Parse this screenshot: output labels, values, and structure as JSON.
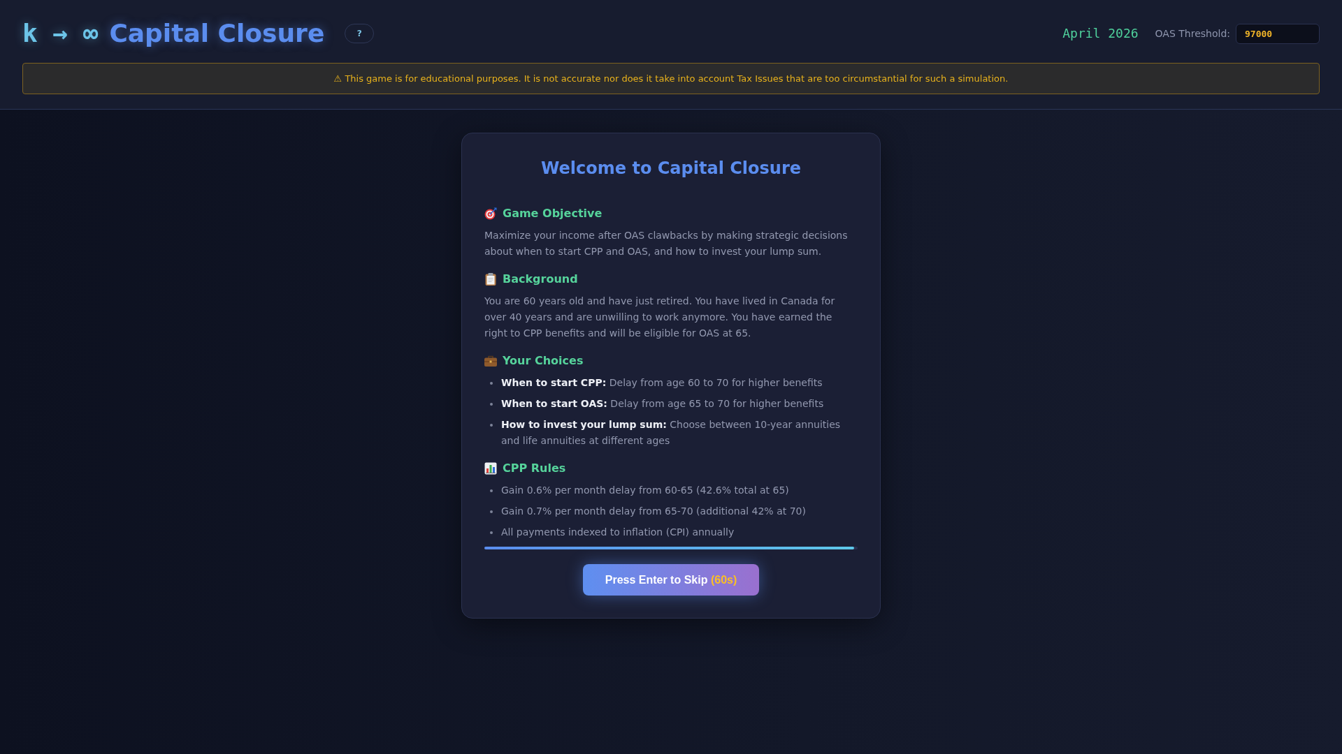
{
  "header": {
    "logo_prefix": "k → ∞",
    "title": "Capital Closure",
    "help_button": "?",
    "date": "April 2026",
    "threshold": {
      "label": "OAS Threshold:",
      "value": "97000"
    }
  },
  "disclaimer": "⚠ This game is for educational purposes. It is not accurate nor does it take into account Tax Issues that are too circumstantial for such a simulation.",
  "welcome_dialog": {
    "title": "Welcome to Capital Closure",
    "sections": [
      {
        "kind": "paragraph",
        "heading": "Game Objective",
        "text": "Maximize your income after OAS clawbacks by making strategic decisions about when to start CPP and OAS, and how to invest your lump sum."
      },
      {
        "kind": "paragraph",
        "heading": "Background",
        "text": "You are 60 years old and have just retired. You have lived in Canada for over 40 years and are unwilling to work anymore. You have earned the right to CPP benefits and will be eligible for OAS at 65."
      },
      {
        "kind": "list",
        "heading": "Your Choices",
        "items": [
          "**When to start CPP:** Delay from age 60 to 70 for higher benefits",
          "**When to start OAS:** Delay from age 65 to 70 for higher benefits",
          "**How to invest your lump sum:** Choose between 10-year annuities and life annuities at different ages"
        ]
      },
      {
        "kind": "list",
        "heading": "CPP Rules",
        "items": [
          "Gain 0.6% per month delay from 60-65 (42.6% total at 65)",
          "Gain 0.7% per month delay from 65-70 (additional 42% at 70)",
          "All payments indexed to inflation (CPI) annually"
        ]
      }
    ],
    "progress": {
      "level": 0.99
    },
    "skip_button": {
      "label": "Press Enter to Skip",
      "countdown": "(60s)"
    }
  }
}
